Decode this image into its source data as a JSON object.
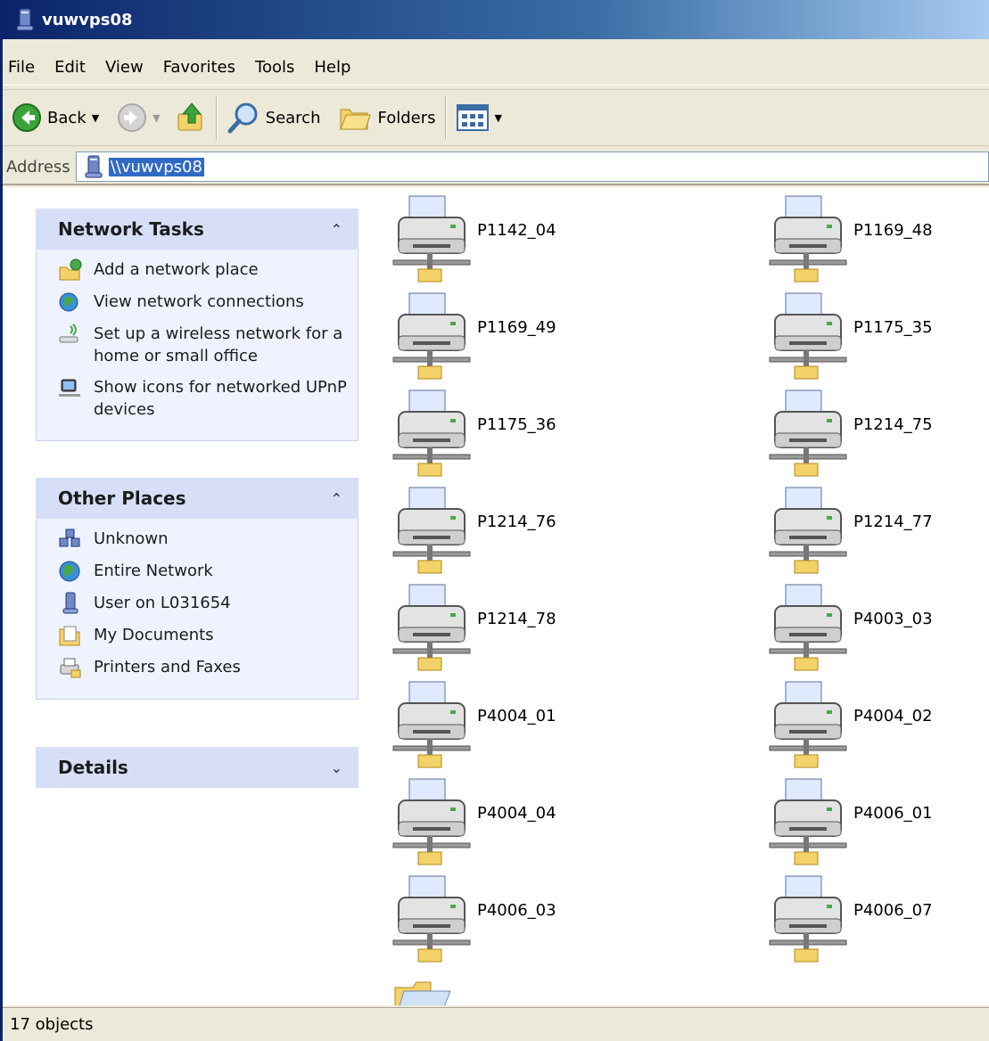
{
  "window": {
    "title": "vuwvps08"
  },
  "menu": [
    "File",
    "Edit",
    "View",
    "Favorites",
    "Tools",
    "Help"
  ],
  "toolbar": {
    "back_label": "Back",
    "search_label": "Search",
    "folders_label": "Folders"
  },
  "address": {
    "label": "Address",
    "value": "\\\\vuwvps08"
  },
  "task_pane": {
    "network_tasks": {
      "title": "Network Tasks",
      "items": [
        {
          "label": "Add a network place",
          "icon": "add-network-place-icon"
        },
        {
          "label": "View network connections",
          "icon": "network-connections-icon"
        },
        {
          "label": "Set up a wireless network for a home or small office",
          "icon": "wireless-network-icon"
        },
        {
          "label": "Show icons for networked UPnP devices",
          "icon": "upnp-devices-icon"
        }
      ]
    },
    "other_places": {
      "title": "Other Places",
      "items": [
        {
          "label": "Unknown",
          "icon": "workgroup-icon"
        },
        {
          "label": "Entire Network",
          "icon": "globe-icon"
        },
        {
          "label": "User on L031654",
          "icon": "computer-icon"
        },
        {
          "label": "My Documents",
          "icon": "documents-folder-icon"
        },
        {
          "label": "Printers and Faxes",
          "icon": "printers-icon"
        }
      ]
    },
    "details": {
      "title": "Details"
    }
  },
  "printers": [
    "P1142_04",
    "P1169_48",
    "P1169_49",
    "P1175_35",
    "P1175_36",
    "P1214_75",
    "P1214_76",
    "P1214_77",
    "P1214_78",
    "P4003_03",
    "P4004_01",
    "P4004_02",
    "P4004_04",
    "P4006_01",
    "P4006_03",
    "P4006_07"
  ],
  "status": {
    "text": "17 objects"
  }
}
